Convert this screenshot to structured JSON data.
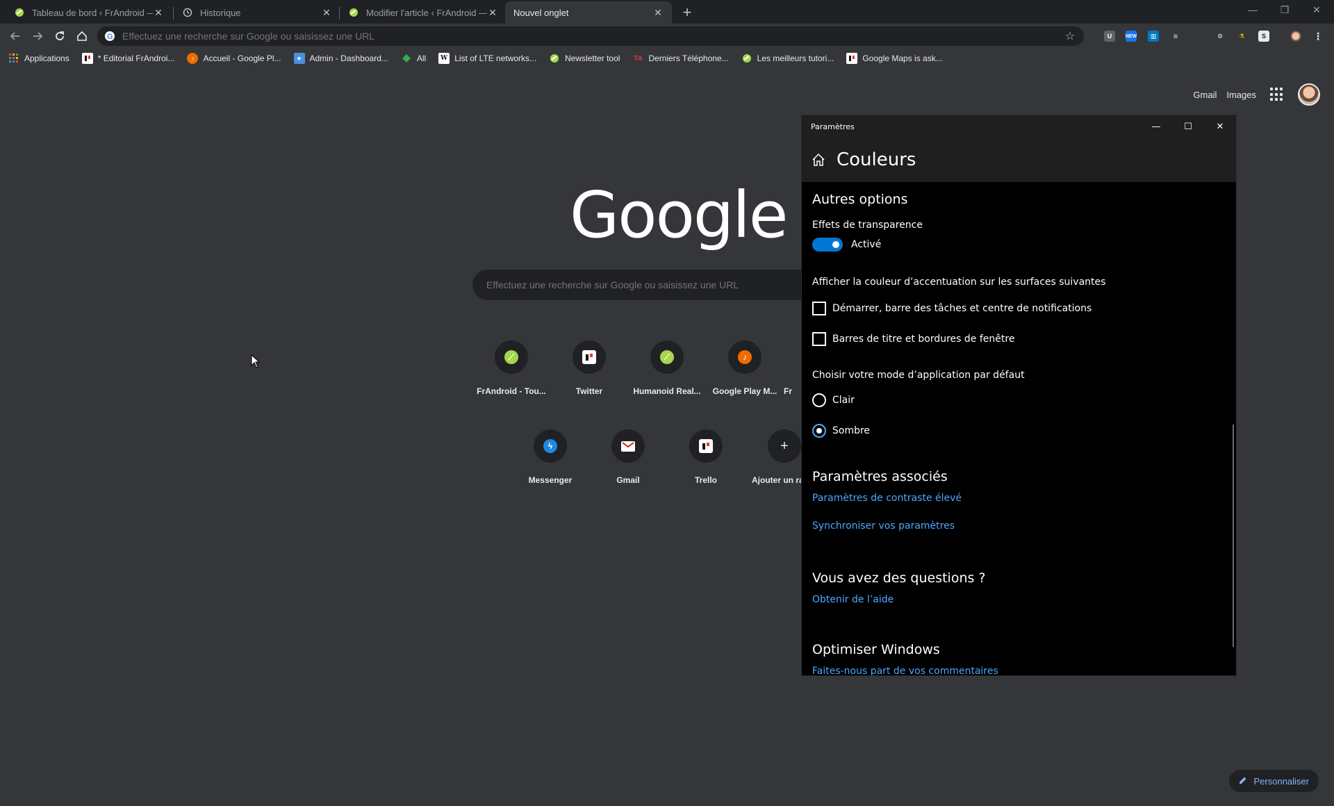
{
  "browser": {
    "tabs": [
      {
        "title": "Tableau de bord ‹ FrAndroid — W",
        "icon": "frandroid-favicon"
      },
      {
        "title": "Historique",
        "icon": "history-icon"
      },
      {
        "title": "Modifier l'article ‹ FrAndroid — W",
        "icon": "frandroid-favicon"
      },
      {
        "title": "Nouvel onglet",
        "icon": ""
      }
    ],
    "new_tab_label": "+",
    "omnibox_placeholder": "Effectuez une recherche sur Google ou saisissez une URL",
    "bookmarks": [
      {
        "label": "Applications",
        "icon": "apps-grid-icon",
        "color": "#e8453c"
      },
      {
        "label": "* Editorial FrAndroi...",
        "icon": "trello-icon",
        "color": "#ffffff"
      },
      {
        "label": "Accueil - Google Pl...",
        "icon": "google-play-music-icon",
        "color": "#ef6c00"
      },
      {
        "label": "Admin - Dashboard...",
        "icon": "admin-icon",
        "color": "#4a90e2"
      },
      {
        "label": "All",
        "icon": "feedly-icon",
        "color": "#2bb24c"
      },
      {
        "label": "List of LTE networks...",
        "icon": "wikipedia-icon",
        "color": "#ffffff"
      },
      {
        "label": "Newsletter tool",
        "icon": "frandroid-favicon",
        "color": "#a5d64c"
      },
      {
        "label": "Derniers Téléphone...",
        "icon": "ta-icon",
        "color": "#e53935"
      },
      {
        "label": "Les meilleurs tutori...",
        "icon": "frandroid-favicon",
        "color": "#a5d64c"
      },
      {
        "label": "Google Maps is ask...",
        "icon": "trello-icon",
        "color": "#ffffff"
      }
    ]
  },
  "ntp": {
    "links": {
      "gmail": "Gmail",
      "images": "Images"
    },
    "logo": "Google",
    "search_placeholder": "Effectuez une recherche sur Google ou saisissez une URL",
    "tiles": [
      {
        "label": "FrAndroid - Tou...",
        "icon": "frandroid-icon"
      },
      {
        "label": "Twitter",
        "icon": "trello-icon"
      },
      {
        "label": "Humanoid Real...",
        "icon": "humanoid-icon"
      },
      {
        "label": "Google Play M...",
        "icon": "google-play-music-icon"
      },
      {
        "label": "Fr",
        "icon": ""
      },
      {
        "label": "Messenger",
        "icon": "messenger-icon"
      },
      {
        "label": "Gmail",
        "icon": "gmail-icon"
      },
      {
        "label": "Trello",
        "icon": "trello-icon"
      },
      {
        "label": "Ajouter un ra",
        "icon": "plus-icon"
      }
    ],
    "customize_label": "Personnaliser"
  },
  "settings": {
    "window_title": "Paramètres",
    "page_title": "Couleurs",
    "other_options_heading": "Autres options",
    "transparency_label": "Effets de transparence",
    "transparency_state": "Activé",
    "accent_surfaces_label": "Afficher la couleur d’accentuation sur les surfaces suivantes",
    "checkbox_start": "Démarrer, barre des tâches et centre de notifications",
    "checkbox_titlebars": "Barres de titre et bordures de fenêtre",
    "app_mode_label": "Choisir votre mode d’application par défaut",
    "radio_light": "Clair",
    "radio_dark": "Sombre",
    "related_heading": "Paramètres associés",
    "link_contrast": "Paramètres de contraste élevé",
    "link_sync": "Synchroniser vos paramètres",
    "questions_heading": "Vous avez des questions ?",
    "link_help": "Obtenir de l’aide",
    "optimize_heading": "Optimiser Windows",
    "link_feedback": "Faites-nous part de vos commentaires",
    "accent_color": "#0078d7"
  }
}
